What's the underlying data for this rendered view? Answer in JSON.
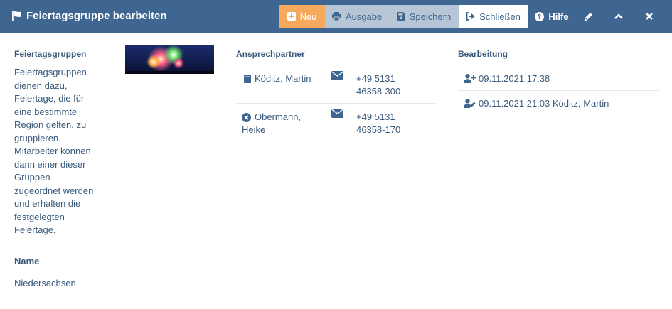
{
  "header": {
    "title": "Feiertagsgruppe bearbeiten",
    "buttons": {
      "new": "Neu",
      "output": "Ausgabe",
      "save": "Speichern",
      "close": "Schließen",
      "help": "Hilfe"
    }
  },
  "info": {
    "label": "Feiertagsgruppen",
    "description_lines": [
      "Feiertagsgruppen",
      "dienen dazu,",
      "Feiertage, die für",
      "eine bestimmte",
      "Region gelten, zu",
      "gruppieren.",
      "Mitarbeiter können",
      "dann einer dieser",
      "Gruppen",
      "zugeordnet werden",
      "und erhalten die",
      "festgelegten",
      "Feiertage."
    ]
  },
  "name": {
    "label": "Name",
    "value": "Niedersachsen"
  },
  "contacts": {
    "label": "Ansprechpartner",
    "items": [
      {
        "name_lines": [
          "Köditz, Martin"
        ],
        "phone_lines": [
          "+49 5131",
          "46358-300"
        ],
        "icon": "book-icon"
      },
      {
        "name_lines": [
          "Obermann,",
          "Heike"
        ],
        "phone_lines": [
          "+49 5131",
          "46358-170"
        ],
        "icon": "x-circle-icon"
      }
    ]
  },
  "history": {
    "label": "Bearbeitung",
    "items": [
      {
        "text": "09.11.2021 17:38",
        "icon": "user-plus-icon"
      },
      {
        "text": "09.11.2021 21:03 Köditz, Martin",
        "icon": "user-edit-icon"
      }
    ]
  },
  "colors": {
    "header": "#3e6690",
    "new_button": "#f5a95c",
    "secondary_button": "#b7c6d6",
    "text": "#3a5a7c",
    "divider": "#e6eaee"
  }
}
